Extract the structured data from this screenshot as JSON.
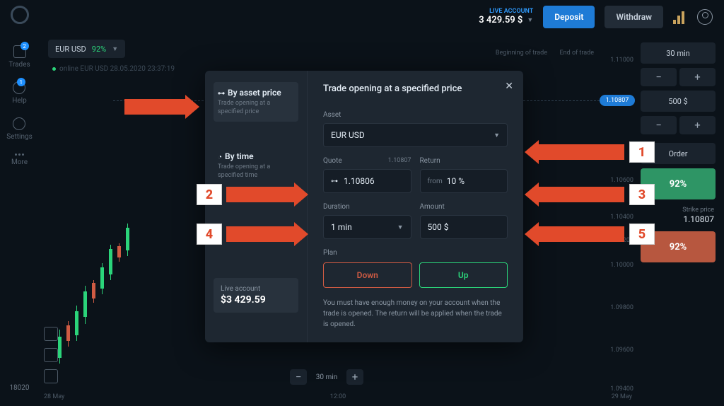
{
  "sidebar": {
    "items": [
      {
        "label": "Trades",
        "badge": "2"
      },
      {
        "label": "Help",
        "badge": "1"
      },
      {
        "label": "Settings"
      },
      {
        "label": "More"
      }
    ],
    "counter": "18020"
  },
  "header": {
    "account_type": "LIVE ACCOUNT",
    "balance": "3 429.59 $",
    "deposit": "Deposit",
    "withdraw": "Withdraw"
  },
  "asset_pill": {
    "name": "EUR USD",
    "pct": "92%"
  },
  "status": "online EUR USD  28.05.2020 23:37:19",
  "trade_panel": {
    "duration": "30 min",
    "amount": "500 $",
    "order": "Order",
    "up_pct": "92%",
    "down_pct": "92%",
    "strike_label": "Strike price",
    "strike_value": "1.10807"
  },
  "chart": {
    "y_ticks": [
      "1.11000",
      "1.10600",
      "1.10400",
      "1.10200",
      "1.10000",
      "1.09800",
      "1.09600",
      "1.09400"
    ],
    "price_tag": "1.10807",
    "trade_labels": {
      "begin": "Beginning\nof trade",
      "end": "End of\ntrade"
    },
    "x_ticks": [
      "28 May",
      "12:00",
      "29 May"
    ],
    "time_control": "30 min"
  },
  "modal": {
    "tabs": [
      {
        "icon": "price",
        "title": "By asset price",
        "desc": "Trade opening at a specified price"
      },
      {
        "icon": "time",
        "title": "By time",
        "desc": "Trade opening at a specified time"
      }
    ],
    "live": {
      "label": "Live account",
      "value": "$3 429.59"
    },
    "title": "Trade opening at a specified price",
    "asset": {
      "label": "Asset",
      "value": "EUR USD"
    },
    "quote": {
      "label": "Quote",
      "hint": "1.10807",
      "value": "1.10806"
    },
    "ret": {
      "label": "Return",
      "from": "from",
      "value": "10 %"
    },
    "duration": {
      "label": "Duration",
      "value": "1 min"
    },
    "amount": {
      "label": "Amount",
      "value": "500 $"
    },
    "plan": {
      "label": "Plan",
      "down": "Down",
      "up": "Up"
    },
    "note": "You must have enough money on your account when the trade is opened. The return will be applied when the trade is opened."
  },
  "annotations": {
    "1": "1",
    "2": "2",
    "3": "3",
    "4": "4",
    "5": "5"
  }
}
